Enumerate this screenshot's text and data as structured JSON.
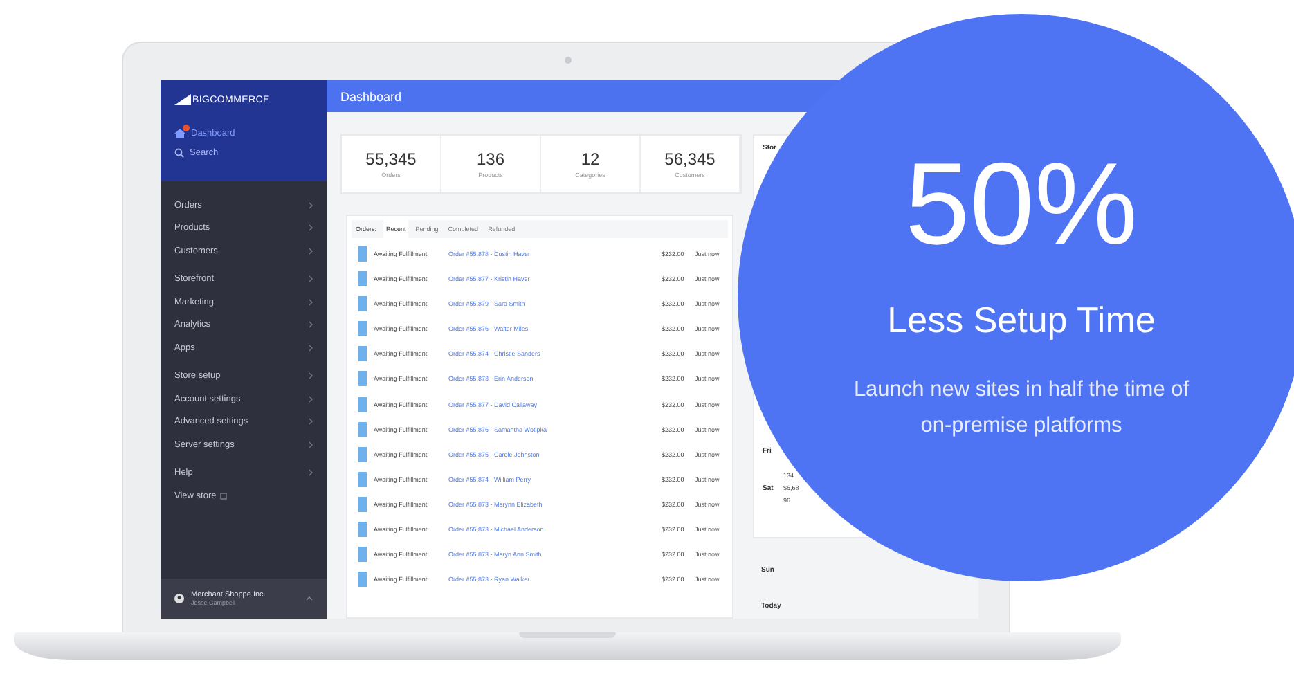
{
  "logo": {
    "text": "BIGCOMMERCE"
  },
  "sidebar": {
    "top_items": [
      {
        "label": "Dashboard",
        "kind": "home",
        "selected": true,
        "badge": true
      },
      {
        "label": "Search",
        "kind": "search",
        "selected": false
      }
    ],
    "groups": [
      [
        {
          "label": "Orders"
        },
        {
          "label": "Products"
        },
        {
          "label": "Customers"
        }
      ],
      [
        {
          "label": "Storefront"
        },
        {
          "label": "Marketing"
        },
        {
          "label": "Analytics"
        },
        {
          "label": "Apps"
        }
      ],
      [
        {
          "label": "Store setup"
        },
        {
          "label": "Account settings"
        },
        {
          "label": "Advanced settings"
        },
        {
          "label": "Server settings"
        }
      ],
      [
        {
          "label": "Help",
          "kind": "chevron"
        },
        {
          "label": "View store",
          "kind": "external"
        }
      ]
    ],
    "account": {
      "name": "Merchant Shoppe Inc.",
      "user": "Jesse Campbell"
    }
  },
  "header": {
    "title": "Dashboard"
  },
  "stats": [
    {
      "value": "55,345",
      "label": "Orders"
    },
    {
      "value": "136",
      "label": "Products"
    },
    {
      "value": "12",
      "label": "Categories"
    },
    {
      "value": "56,345",
      "label": "Customers"
    }
  ],
  "orders": {
    "label": "Orders:",
    "tabs": [
      {
        "label": "Recent",
        "selected": true
      },
      {
        "label": "Pending",
        "selected": false
      },
      {
        "label": "Completed",
        "selected": false
      },
      {
        "label": "Refunded",
        "selected": false
      }
    ],
    "rows": [
      {
        "status": "Awaiting Fulfillment",
        "order": "Order #55,878 - Dustin Haver",
        "amount": "$232.00",
        "time": "Just now"
      },
      {
        "status": "Awaiting Fulfillment",
        "order": "Order #55,877 - Kristin Haver",
        "amount": "$232.00",
        "time": "Just now"
      },
      {
        "status": "Awaiting Fulfillment",
        "order": "Order #55,879 - Sara Smith",
        "amount": "$232.00",
        "time": "Just now"
      },
      {
        "status": "Awaiting Fulfillment",
        "order": "Order #55,876 - Walter Miles",
        "amount": "$232.00",
        "time": "Just now"
      },
      {
        "status": "Awaiting Fulfillment",
        "order": "Order #55,874 - Christie Sanders",
        "amount": "$232.00",
        "time": "Just now"
      },
      {
        "status": "Awaiting Fulfillment",
        "order": "Order #55,873 - Erin Anderson",
        "amount": "$232.00",
        "time": "Just now"
      },
      {
        "status": "Awaiting Fulfillment",
        "order": "Order #55,877 - David Callaway",
        "amount": "$232.00",
        "time": "Just now"
      },
      {
        "status": "Awaiting Fulfillment",
        "order": "Order #55,876 - Samantha Wotipka",
        "amount": "$232.00",
        "time": "Just now"
      },
      {
        "status": "Awaiting Fulfillment",
        "order": "Order #55,875 - Carole Johnston",
        "amount": "$232.00",
        "time": "Just now"
      },
      {
        "status": "Awaiting Fulfillment",
        "order": "Order #55,874 - William Perry",
        "amount": "$232.00",
        "time": "Just now"
      },
      {
        "status": "Awaiting Fulfillment",
        "order": "Order #55,873 - Marynn Elizabeth",
        "amount": "$232.00",
        "time": "Just now"
      },
      {
        "status": "Awaiting Fulfillment",
        "order": "Order #55,873 - Michael Anderson",
        "amount": "$232.00",
        "time": "Just now"
      },
      {
        "status": "Awaiting Fulfillment",
        "order": "Order #55,873 - Maryn Ann Smith",
        "amount": "$232.00",
        "time": "Just now"
      },
      {
        "status": "Awaiting Fulfillment",
        "order": "Order #55,873 - Ryan Walker",
        "amount": "$232.00",
        "time": "Just now"
      }
    ]
  },
  "store_panel": {
    "title": "Stor",
    "days": [
      {
        "day": "Fri"
      },
      {
        "day": "Sat",
        "values": [
          "134",
          "$6,68",
          "96"
        ]
      }
    ],
    "after": [
      {
        "day": "Sun"
      },
      {
        "day": "Today"
      }
    ]
  },
  "promo": {
    "headline": "50%",
    "title": "Less Setup Time",
    "text": "Launch new sites in half the time of on-premise platforms"
  }
}
